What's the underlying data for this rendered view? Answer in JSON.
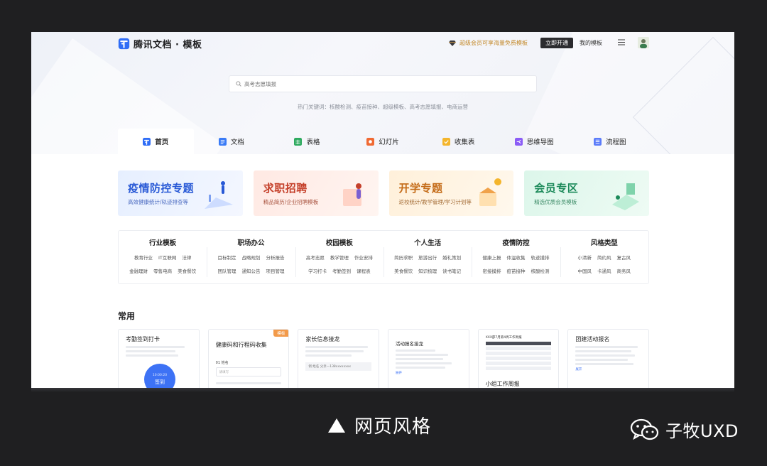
{
  "header": {
    "logo_text": "腾讯文档 · 模板",
    "promo_text": "超级会员可享海量免费模板",
    "open_button": "立即开通",
    "my_templates": "我的模板"
  },
  "search": {
    "placeholder": "高考志愿填报",
    "hot_keywords": "热门关键词：核酸检测、疫苗接种、超级模板、高考志愿填报、电商运营"
  },
  "tabs": [
    {
      "label": "首页",
      "icon": "home-icon",
      "color": "#2f6df6"
    },
    {
      "label": "文档",
      "icon": "doc-icon",
      "color": "#3a7bf6"
    },
    {
      "label": "表格",
      "icon": "sheet-icon",
      "color": "#2eaa5f"
    },
    {
      "label": "幻灯片",
      "icon": "slides-icon",
      "color": "#f06a33"
    },
    {
      "label": "收集表",
      "icon": "form-icon",
      "color": "#f4b52c"
    },
    {
      "label": "思维导图",
      "icon": "mindmap-icon",
      "color": "#8b5cf6"
    },
    {
      "label": "流程图",
      "icon": "flowchart-icon",
      "color": "#5b7cfa"
    }
  ],
  "banners": [
    {
      "title": "疫情防控专题",
      "subtitle": "高效健康统计/轨迹排查等"
    },
    {
      "title": "求职招聘",
      "subtitle": "精品简历/企业招聘模板"
    },
    {
      "title": "开学专题",
      "subtitle": "返校统计/教学管理/学习计划等"
    },
    {
      "title": "会员专区",
      "subtitle": "精选优质会员模板"
    }
  ],
  "categories": [
    {
      "title": "行业模板",
      "row1": [
        "教育行业",
        "IT互联网",
        "法律"
      ],
      "row2": [
        "金融理财",
        "零售电商",
        "美食餐饮"
      ]
    },
    {
      "title": "职场办公",
      "row1": [
        "目标制定",
        "战略规划",
        "分析报告"
      ],
      "row2": [
        "团队管理",
        "通知公告",
        "项目管理"
      ]
    },
    {
      "title": "校园模板",
      "row1": [
        "高考志愿",
        "教学管理",
        "作业安排"
      ],
      "row2": [
        "学习打卡",
        "考勤签到",
        "课程表"
      ]
    },
    {
      "title": "个人生活",
      "row1": [
        "简历求职",
        "旅游出行",
        "婚礼策划"
      ],
      "row2": [
        "美食餐饮",
        "知识梳理",
        "读书笔记"
      ]
    },
    {
      "title": "疫情防控",
      "row1": [
        "健康上报",
        "体温收集",
        "轨迹摸排"
      ],
      "row2": [
        "密接摸排",
        "疫苗接种",
        "核酸检测"
      ]
    },
    {
      "title": "风格类型",
      "row1": [
        "小清新",
        "简约风",
        "复古风"
      ],
      "row2": [
        "中国风",
        "卡通风",
        "商务风"
      ]
    }
  ],
  "common": {
    "title": "常用",
    "cards": [
      {
        "title": "考勤签到打卡",
        "button": "签到",
        "time": "10:00:20"
      },
      {
        "title": "健康码和行程码收集",
        "tag": "模板",
        "field_label": "01  姓名",
        "field_placeholder": "请填写"
      },
      {
        "title": "家长信息接龙",
        "row": "例  姓名   父亲—138xxxxxxxx"
      },
      {
        "title": "活动报名接龙",
        "link": "展开"
      },
      {
        "title": "XXX部7月第4周工作周报",
        "subtitle": "小组工作周报"
      },
      {
        "title": "团建活动报名",
        "link": "展开"
      }
    ]
  },
  "caption": {
    "text": "网页风格",
    "brand": "子牧UXD"
  }
}
